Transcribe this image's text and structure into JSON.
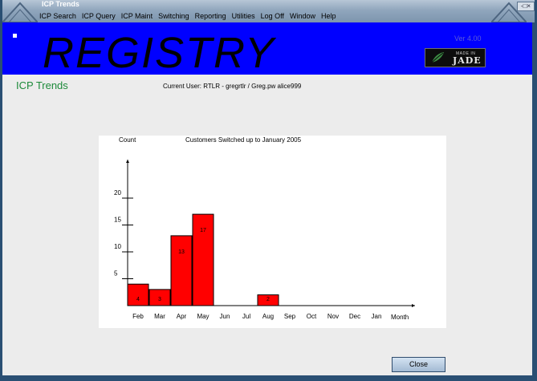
{
  "window": {
    "title": "ICP Trends",
    "control_label": "-□×"
  },
  "menu": [
    "ICP Search",
    "ICP Query",
    "ICP Maint",
    "Switching",
    "Reporting",
    "Utilities",
    "Log Off",
    "Window",
    "Help"
  ],
  "banner": {
    "logo": "REGISTRY",
    "version": "Ver 4.00",
    "badge_top": "MADE IN",
    "badge_main": "JADE",
    "background": "#0000ff"
  },
  "page": {
    "title": "ICP Trends",
    "current_user": "Current User: RTLR - gregrtlr / Greg.pw alice999"
  },
  "buttons": {
    "close": "Close"
  },
  "chart_data": {
    "type": "bar",
    "title": "Customers Switched up to January 2005",
    "ylabel": "Count",
    "xlabel": "Month",
    "categories": [
      "Feb",
      "Mar",
      "Apr",
      "May",
      "Jun",
      "Jul",
      "Aug",
      "Sep",
      "Oct",
      "Nov",
      "Dec",
      "Jan"
    ],
    "values": [
      4,
      3,
      13,
      17,
      0,
      0,
      2,
      0,
      0,
      0,
      0,
      0
    ],
    "data_labels": [
      "4",
      "3",
      "13",
      "17",
      "",
      "",
      "2",
      "",
      "",
      "",
      "",
      ""
    ],
    "y_ticks": [
      5,
      10,
      15,
      20
    ],
    "ylim": [
      0,
      25
    ],
    "bar_color": "#ff0000"
  }
}
